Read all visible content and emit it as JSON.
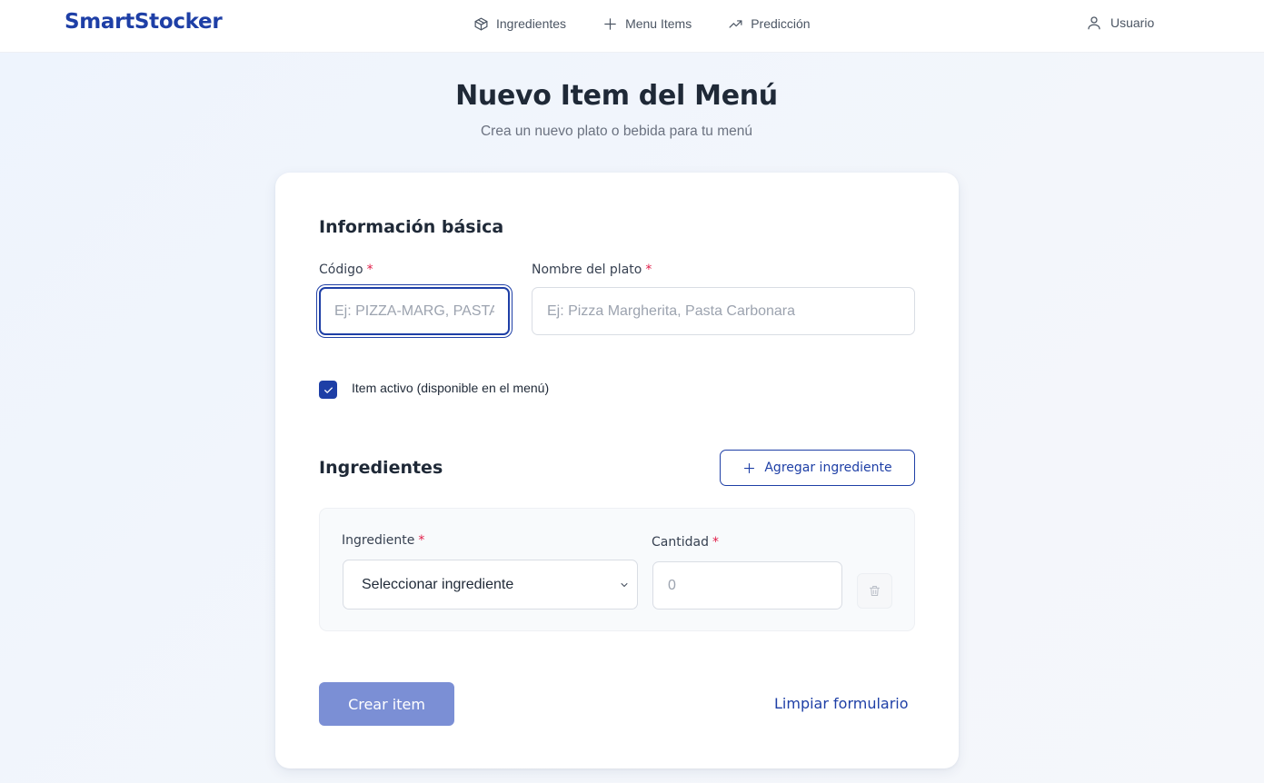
{
  "header": {
    "brand": "SmartStocker",
    "nav": [
      {
        "label": "Ingredientes",
        "icon": "box-icon"
      },
      {
        "label": "Menu Items",
        "icon": "plus-icon"
      },
      {
        "label": "Predicción",
        "icon": "trending-up-icon"
      }
    ],
    "user_label": "Usuario"
  },
  "page": {
    "title": "Nuevo Item del Menú",
    "subtitle": "Crea un nuevo plato o bebida para tu menú"
  },
  "form": {
    "basic_section_title": "Información básica",
    "code": {
      "label": "Código",
      "required_mark": "*",
      "placeholder": "Ej: PIZZA-MARG, PASTA-CARB",
      "value": ""
    },
    "name": {
      "label": "Nombre del plato",
      "required_mark": "*",
      "placeholder": "Ej: Pizza Margherita, Pasta Carbonara",
      "value": ""
    },
    "active": {
      "label": "Item activo (disponible en el menú)",
      "checked": true
    },
    "ingredients_section_title": "Ingredientes",
    "add_ingredient_label": "Agregar ingrediente",
    "ingredient_row": {
      "ingredient_label": "Ingrediente",
      "ingredient_required_mark": "*",
      "ingredient_selected": "Seleccionar ingrediente",
      "quantity_label": "Cantidad",
      "quantity_required_mark": "*",
      "quantity_placeholder": "0"
    },
    "submit_label": "Crear item",
    "clear_label": "Limpiar formulario"
  },
  "colors": {
    "accent": "#1e3fa6",
    "submit_disabled": "#7b8fd5",
    "required": "#e11d48"
  }
}
